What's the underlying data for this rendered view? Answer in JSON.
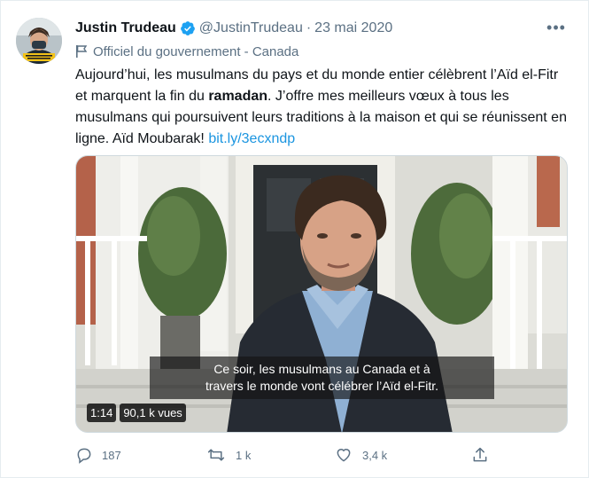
{
  "tweet": {
    "author": {
      "name": "Justin Trudeau",
      "handle": "@JustinTrudeau",
      "separator": "·",
      "date": "23 mai 2020",
      "avatar_icon": "avatar-photo",
      "verified_color": "#1da1f2"
    },
    "government_label": "Officiel du gouvernement - Canada",
    "body": {
      "part1": "Aujourd’hui, les musulmans du pays et du monde entier célèbrent l’Aïd el-Fitr et marquent la fin du ",
      "bold": "ramadan",
      "part2": ". J’offre mes meilleurs vœux à tous les musulmans qui poursuivent leurs traditions à la maison et qui se réunissent en ligne. Aïd Moubarak! ",
      "link": "bit.ly/3ecxndp",
      "link_color": "#1b95e0"
    },
    "video": {
      "subtitle_line1": "Ce soir, les musulmans au Canada et à",
      "subtitle_line2": "travers le monde vont célébrer l’Aïd el-Fitr.",
      "duration": "1:14",
      "views": "90,1 k vues"
    },
    "actions": {
      "replies": "187",
      "retweets": "1 k",
      "likes": "3,4 k"
    },
    "more_label": "•••"
  }
}
